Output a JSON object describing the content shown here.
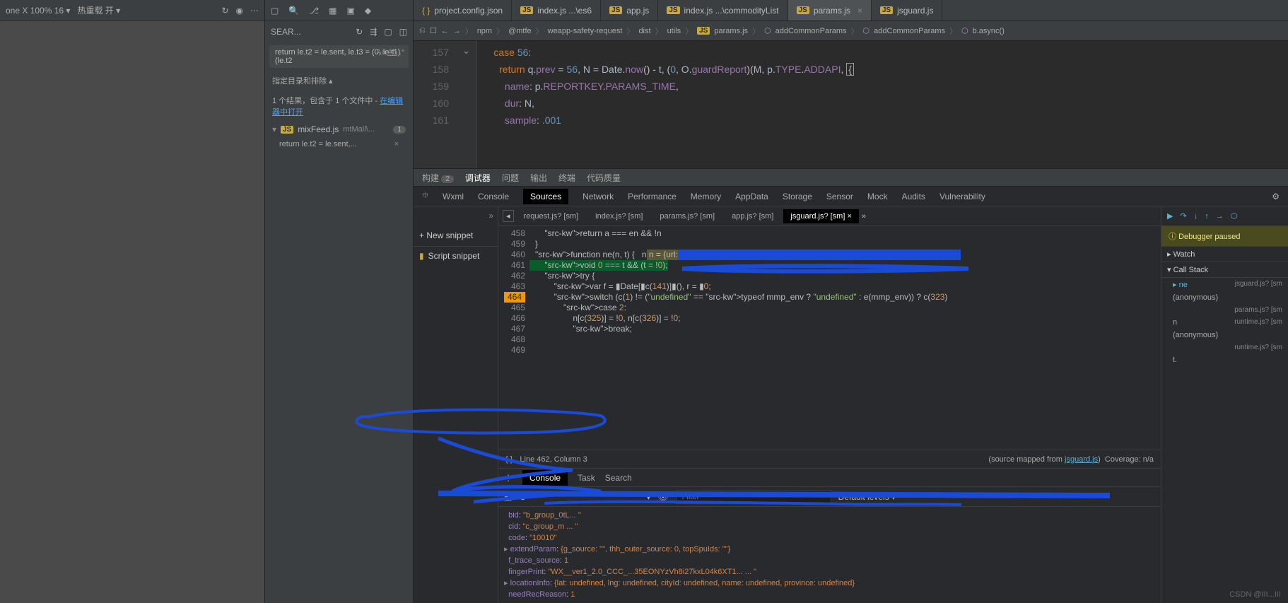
{
  "topbar": {
    "device": "one X 100% 16 ▾",
    "hotreload": "热重载 开 ▾"
  },
  "search": {
    "header": "SEAR...",
    "query": "return le.t2 = le.sent, le.t3 = (0, le.t1)(le.t2",
    "dir_label": "指定目录和排除 ▴",
    "results_text": "1 个结果，包含于 1 个文件中 - ",
    "editor_link": "在编辑器中打开",
    "file_name": "mixFeed.js",
    "file_path": "mtMall\\...",
    "file_count": "1",
    "match_line": "return le.t2 = le.sent,..."
  },
  "tabs": [
    {
      "icon": "braces",
      "label": "project.config.json"
    },
    {
      "icon": "js",
      "label": "index.js ...\\es6"
    },
    {
      "icon": "js",
      "label": "app.js"
    },
    {
      "icon": "js",
      "label": "index.js ...\\commodityList"
    },
    {
      "icon": "js",
      "label": "params.js",
      "active": true,
      "close": true
    },
    {
      "icon": "js",
      "label": "jsguard.js"
    }
  ],
  "breadcrumb": [
    "npm",
    "@mtfe",
    "weapp-safety-request",
    "dist",
    "utils",
    "params.js",
    "addCommonParams",
    "addCommonParams",
    "b.async()"
  ],
  "editor_lines": [
    {
      "n": "157",
      "html": "      <span class='kw'>case</span> <span class='num'>56</span><span class='paren'>:</span>"
    },
    {
      "n": "158",
      "html": "        <span class='kw'>return</span> <span class='ident'>q</span>.<span class='prop'>prev</span> = <span class='num'>56</span>, <span class='ident'>N</span> = <span class='ident'>Date</span>.<span class='prop'>now</span>() - <span class='ident'>t</span>, (<span class='num'>0</span>, <span class='ident'>O</span>.<span class='prop'>guardReport</span>)(<span class='ident'>M</span>, <span class='ident'>p</span>.<span class='prop'>TYPE</span>.<span class='prop'>ADDAPI</span>, <span class='hl-box'>{</span>"
    },
    {
      "n": "159",
      "html": "          <span class='prop'>name</span>: <span class='ident'>p</span>.<span class='prop'>REPORTKEY</span>.<span class='prop'>PARAMS_TIME</span>,"
    },
    {
      "n": "160",
      "html": "          <span class='prop'>dur</span>: <span class='ident'>N</span>,"
    },
    {
      "n": "161",
      "html": "          <span class='prop'>sample</span>: <span class='num'>.001</span>"
    }
  ],
  "bottom_tabs": {
    "build": "构建",
    "build_badge": "2",
    "debugger": "调试器",
    "problems": "问题",
    "output": "输出",
    "terminal": "终端",
    "quality": "代码质量"
  },
  "devtools_tabs": [
    "Wxml",
    "Console",
    "Sources",
    "Network",
    "Performance",
    "Memory",
    "AppData",
    "Storage",
    "Sensor",
    "Mock",
    "Audits",
    "Vulnerability"
  ],
  "snippet": {
    "new": "+ New snippet",
    "item": "Script snippet"
  },
  "src_tabs": [
    {
      "label": "request.js? [sm]"
    },
    {
      "label": "index.js? [sm]"
    },
    {
      "label": "params.js? [sm]"
    },
    {
      "label": "app.js? [sm]"
    },
    {
      "label": "jsguard.js? [sm]",
      "active": true,
      "close": true
    }
  ],
  "src_lines": [
    {
      "n": "458",
      "t": "    return a === en && !n"
    },
    {
      "n": "459",
      "t": "}"
    },
    {
      "n": "460",
      "t": ""
    },
    {
      "n": "461",
      "t": "function ne(n, t) {   n = {url:",
      "blue": true
    },
    {
      "n": "462",
      "t": "    void 0 === t && (t = !0);",
      "green": true
    },
    {
      "n": "463",
      "t": "    try {"
    },
    {
      "n": "464",
      "t": "        var f = ▮Date[▮c(141)]▮(), r = ▮0;",
      "bp": true
    },
    {
      "n": "465",
      "t": "        switch (c(1) != (\"undefined\" == typeof mmp_env ? \"undefined\" : e(mmp_env)) ? c(323)"
    },
    {
      "n": "466",
      "t": "            case 2:"
    },
    {
      "n": "467",
      "t": "                n[c(325)] = !0, n[c(326)] = !0;"
    },
    {
      "n": "468",
      "t": "                break;"
    },
    {
      "n": "469",
      "t": ""
    }
  ],
  "src_status": {
    "pos": "Line 462, Column 3",
    "mapped_prefix": "(source mapped from ",
    "mapped_link": "jsguard.js",
    "mapped_suffix": ")",
    "coverage": "Coverage: n/a"
  },
  "debugger": {
    "paused": "Debugger paused",
    "watch": "Watch",
    "callstack": "Call Stack",
    "frames": [
      {
        "fn": "ne",
        "file": "jsguard.js? [sm",
        "current": true
      },
      {
        "fn": "(anonymous)",
        "file": ""
      },
      {
        "fn": "",
        "file": "params.js? [sm"
      },
      {
        "fn": "n",
        "file": "runtime.js? [sm"
      },
      {
        "fn": "(anonymous)",
        "file": ""
      },
      {
        "fn": "",
        "file": "runtime.js? [sm"
      },
      {
        "fn": "t.<computed>",
        "file": ""
      }
    ]
  },
  "console": {
    "tabs": [
      "Console",
      "Task",
      "Search"
    ],
    "filter_placeholder": "Filter",
    "levels": "Default levels ▾",
    "lines": [
      {
        "k": "bid",
        "v": "\"b_group_0tL...  \""
      },
      {
        "k": "cid",
        "v": "\"c_group_m  ...  \""
      },
      {
        "k": "code",
        "v": "\"10010\""
      },
      {
        "k": "extendParam",
        "v": "{g_source: \"\", thh_outer_source: 0, topSpuIds: \"\"}",
        "expand": true
      },
      {
        "k": "f_trace_source",
        "v": "1"
      },
      {
        "k": "fingerPrint",
        "v": "\"WX__ver1_2.0_CCC_...35EONYzVh8i27kxL04k6XT1...  ...  \"",
        "hl": true
      },
      {
        "k": "locationInfo",
        "v": "{lat: undefined, lng: undefined, cityId: undefined, name: undefined, province: undefined}",
        "expand": true
      },
      {
        "k": "needRecReason",
        "v": "1"
      }
    ]
  },
  "watermark": "CSDN @III...III"
}
